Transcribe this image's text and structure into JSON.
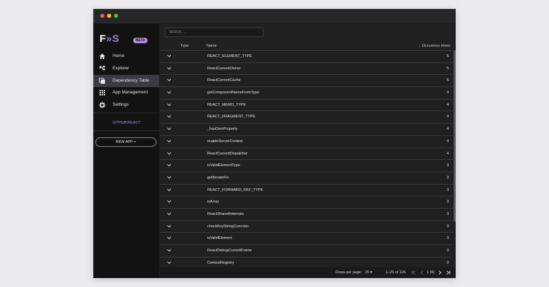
{
  "app": {
    "logo_main": "F",
    "logo_accent": "»S",
    "badge": "BETA"
  },
  "sidebar": {
    "items": [
      {
        "label": "Home",
        "icon": "home-icon"
      },
      {
        "label": "Explorer",
        "icon": "explorer-icon"
      },
      {
        "label": "Dependency Table",
        "icon": "dependency-table-icon",
        "active": true
      },
      {
        "label": "App Management",
        "icon": "grid-icon"
      },
      {
        "label": "Settings",
        "icon": "gear-icon"
      }
    ],
    "repo": "GITHUB/REACT",
    "new_app_label": "NEW APP",
    "new_app_icon": "+"
  },
  "search": {
    "placeholder": "search..."
  },
  "table": {
    "columns": {
      "type": "Type",
      "name": "Name",
      "occurrence": "Occurence times",
      "sort_icon": "↓"
    },
    "rows": [
      {
        "name": "REACT_ELEMENT_TYPE",
        "count": "5"
      },
      {
        "name": "ReactCurrentOwner",
        "count": "5"
      },
      {
        "name": "ReactCurrentCache",
        "count": "5"
      },
      {
        "name": "getComponentNameFromType",
        "count": "4"
      },
      {
        "name": "REACT_MEMO_TYPE",
        "count": "4"
      },
      {
        "name": "REACT_FRAGMENT_TYPE",
        "count": "4"
      },
      {
        "name": "_hasOwnProperty",
        "count": "4"
      },
      {
        "name": "enableServerContext",
        "count": "4"
      },
      {
        "name": "ReactCurrentDispatcher",
        "count": "4"
      },
      {
        "name": "isValidElementType",
        "count": "3"
      },
      {
        "name": "getIteratorFn",
        "count": "3"
      },
      {
        "name": "REACT_FORWARD_REF_TYPE",
        "count": "3"
      },
      {
        "name": "isArray",
        "count": "3"
      },
      {
        "name": "ReactSharedInternals",
        "count": "3"
      },
      {
        "name": "checkKeyStringCoercion",
        "count": "3"
      },
      {
        "name": "isValidElement",
        "count": "3"
      },
      {
        "name": "ReactDebugCurrentFrame",
        "count": "3"
      },
      {
        "name": "ContextRegistry",
        "count": "3"
      }
    ]
  },
  "pagination": {
    "rows_per_page_label": "Rows per page:",
    "rows_per_page_value": "25",
    "range": "1–25 of 126",
    "page": "1 (6)"
  },
  "colors": {
    "accent": "#9b7fe0",
    "badge": "#b08ee0",
    "active_nav": "#3a3a44"
  }
}
